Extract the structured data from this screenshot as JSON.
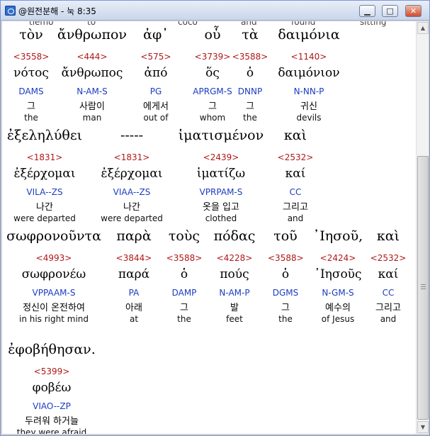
{
  "window": {
    "title": "@원전분해 - 눅 8:35",
    "buttons": {
      "minimize": "▁",
      "maximize": "□",
      "close": "✕"
    }
  },
  "clipped_row": [
    "tiemo",
    "to",
    "coco",
    "and",
    "found",
    "sitting"
  ],
  "rows": [
    [
      {
        "greek": "τὸν",
        "strong": "<3558>",
        "lemma": "νότος",
        "morph": "DAMS",
        "korean": "그",
        "english": "the"
      },
      {
        "greek": "ἄνθρωπον",
        "strong": "<444>",
        "lemma": "ἄνθρωπος",
        "morph": "N-AM-S",
        "korean": "사람이",
        "english": "man"
      },
      {
        "greek": "ἀφ᾽",
        "strong": "<575>",
        "lemma": "ἀπό",
        "morph": "PG",
        "korean": "에게서",
        "english": "out of"
      },
      {
        "greek": "οὗ",
        "strong": "<3739>",
        "lemma": "ὅς",
        "morph": "APRGM-S",
        "korean": "그",
        "english": "whom"
      },
      {
        "greek": "τὰ",
        "strong": "<3588>",
        "lemma": "ὁ",
        "morph": "DNNP",
        "korean": "그",
        "english": "the"
      },
      {
        "greek": "δαιμόνια",
        "strong": "<1140>",
        "lemma": "δαιμόνιον",
        "morph": "N-NN-P",
        "korean": "귀신",
        "english": "devils"
      }
    ],
    [
      {
        "greek": "ἐξεληλύθει",
        "strong": "<1831>",
        "lemma": "ἐξέρχομαι",
        "morph": "VILA--ZS",
        "korean": "나간",
        "english": "were departed"
      },
      {
        "greek": "-----",
        "strong": "<1831>",
        "lemma": "ἐξέρχομαι",
        "morph": "VIAA--ZS",
        "korean": "나간",
        "english": "were departed"
      },
      {
        "greek": "ἱματισμένον",
        "strong": "<2439>",
        "lemma": "ἱματίζω",
        "morph": "VPRPAM-S",
        "korean": "옷을 입고",
        "english": "clothed"
      },
      {
        "greek": "καὶ",
        "strong": "<2532>",
        "lemma": "καί",
        "morph": "CC",
        "korean": "그리고",
        "english": "and"
      }
    ],
    [
      {
        "greek": "σωφρονοῦντα",
        "strong": "<4993>",
        "lemma": "σωφρονέω",
        "morph": "VPPAAM-S",
        "korean": "정신이 온전하여",
        "english": "in his right mind"
      },
      {
        "greek": "παρὰ",
        "strong": "<3844>",
        "lemma": "παρά",
        "morph": "PA",
        "korean": "아래",
        "english": "at"
      },
      {
        "greek": "τοὺς",
        "strong": "<3588>",
        "lemma": "ὁ",
        "morph": "DAMP",
        "korean": "그",
        "english": "the"
      },
      {
        "greek": "πόδας",
        "strong": "<4228>",
        "lemma": "πούς",
        "morph": "N-AM-P",
        "korean": "발",
        "english": "feet"
      },
      {
        "greek": "τοῦ",
        "strong": "<3588>",
        "lemma": "ὁ",
        "morph": "DGMS",
        "korean": "그",
        "english": "the"
      },
      {
        "greek": "᾽Ιησοῦ,",
        "strong": "<2424>",
        "lemma": "᾽Ιησοῦς",
        "morph": "N-GM-S",
        "korean": "예수의",
        "english": "of Jesus"
      },
      {
        "greek": "καὶ",
        "strong": "<2532>",
        "lemma": "καί",
        "morph": "CC",
        "korean": "그리고",
        "english": "and"
      }
    ],
    [
      {
        "greek": "ἐφοβήθησαν.",
        "strong": "<5399>",
        "lemma": "φοβέω",
        "morph": "VIAO--ZP",
        "korean": "두려워 하거늘",
        "english": "they were afraid"
      }
    ]
  ]
}
